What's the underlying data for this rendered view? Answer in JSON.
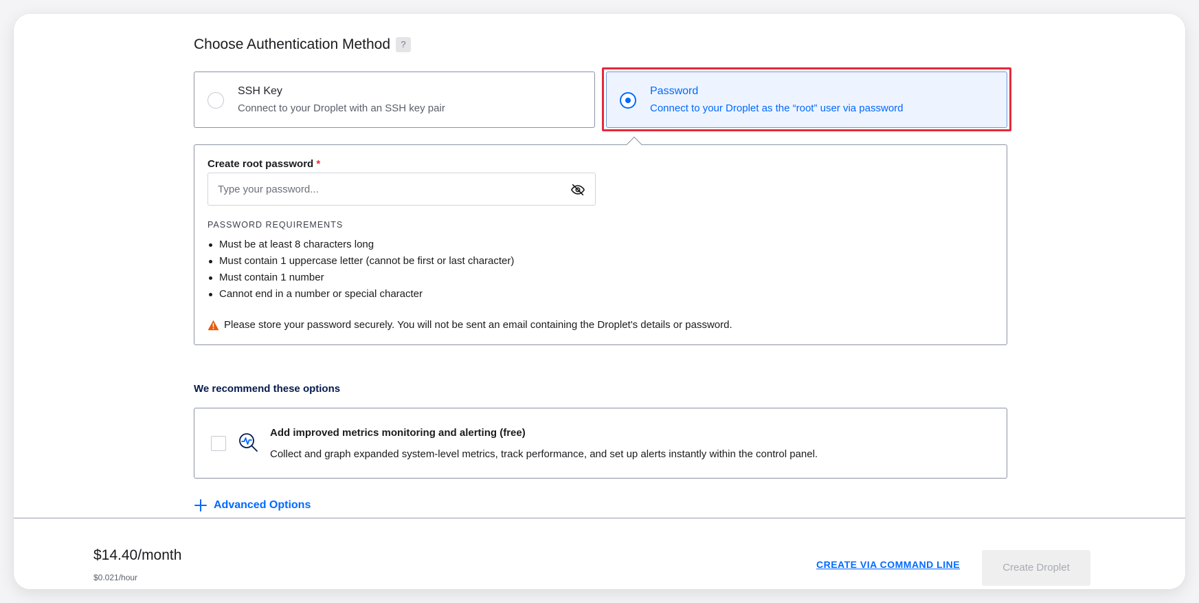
{
  "auth": {
    "title": "Choose Authentication Method",
    "help": "?",
    "options": [
      {
        "title": "SSH Key",
        "subtitle": "Connect to your Droplet with an SSH key pair",
        "selected": false
      },
      {
        "title": "Password",
        "subtitle": "Connect to your Droplet as the “root” user via password",
        "selected": true
      }
    ]
  },
  "password": {
    "label": "Create root password",
    "required_mark": "*",
    "placeholder": "Type your password...",
    "value": "",
    "toggle_icon": "eye-slash-icon",
    "requirements_heading": "PASSWORD REQUIREMENTS",
    "requirements": [
      "Must be at least 8 characters long",
      "Must contain 1 uppercase letter (cannot be first or last character)",
      "Must contain 1 number",
      "Cannot end in a number or special character"
    ],
    "warning": "Please store your password securely. You will not be sent an email containing the Droplet's details or password."
  },
  "recommend": {
    "heading": "We recommend these options",
    "monitoring": {
      "title": "Add improved metrics monitoring and alerting (free)",
      "subtitle": "Collect and graph expanded system-level metrics, track performance, and set up alerts instantly within the control panel.",
      "checked": false
    }
  },
  "advanced": {
    "label": "Advanced Options"
  },
  "footer": {
    "price_month": "$14.40/month",
    "price_hour": "$0.021/hour",
    "cli_link": "CREATE VIA COMMAND LINE",
    "create_button": "Create Droplet"
  },
  "colors": {
    "accent": "#0069ff",
    "highlight": "#e2293b",
    "warning": "#e8590c"
  }
}
